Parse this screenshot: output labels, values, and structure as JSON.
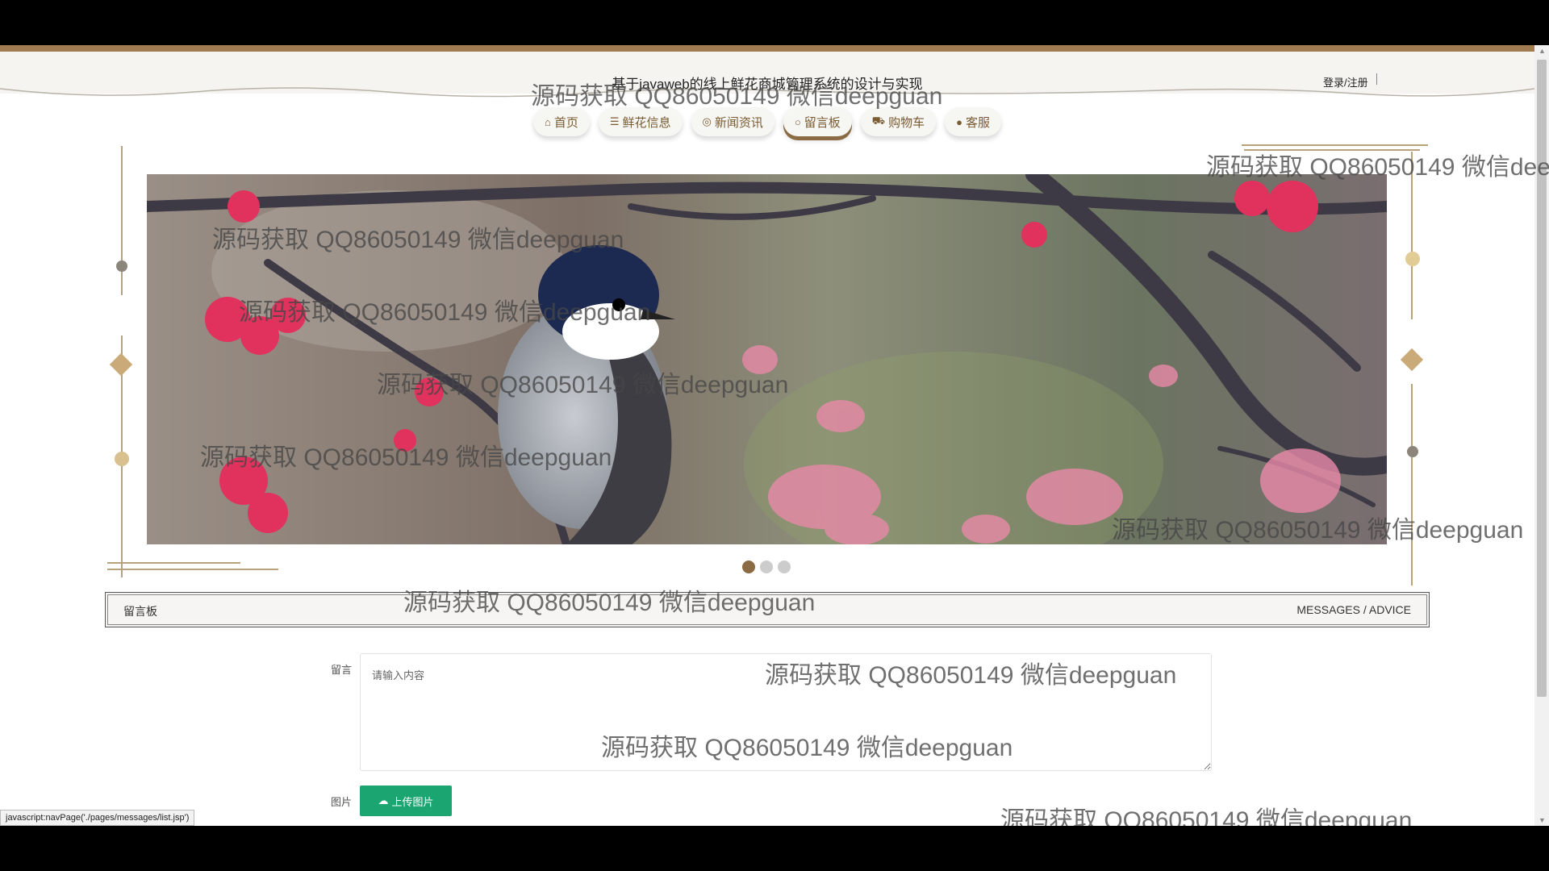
{
  "header": {
    "site_title": "基于javaweb的线上鲜花商城管理系统的设计与实现",
    "auth_link": "登录/注册"
  },
  "nav": {
    "items": [
      {
        "label": "首页",
        "icon": "home-icon"
      },
      {
        "label": "鲜花信息",
        "icon": "sliders-icon"
      },
      {
        "label": "新闻资讯",
        "icon": "news-icon"
      },
      {
        "label": "留言板",
        "icon": "message-icon",
        "active": true
      },
      {
        "label": "购物车",
        "icon": "cart-icon"
      },
      {
        "label": "客服",
        "icon": "customer-service-icon"
      }
    ]
  },
  "carousel": {
    "slide_count": 3,
    "active_index": 0,
    "image_subject": "bird-on-plum-blossom"
  },
  "section": {
    "title": "留言板",
    "subtitle": "MESSAGES / ADVICE"
  },
  "form": {
    "message_label": "留言",
    "message_placeholder": "请输入内容",
    "image_label": "图片",
    "upload_button": "上传图片"
  },
  "status_bar": {
    "link_preview": "javascript:navPage('./pages/messages/list.jsp')"
  },
  "watermark": {
    "text": "源码获取 QQ86050149 微信deepguan"
  },
  "colors": {
    "accent": "#8b6b43",
    "upload_green": "#1aa571",
    "top_strip": "#a07b52"
  }
}
